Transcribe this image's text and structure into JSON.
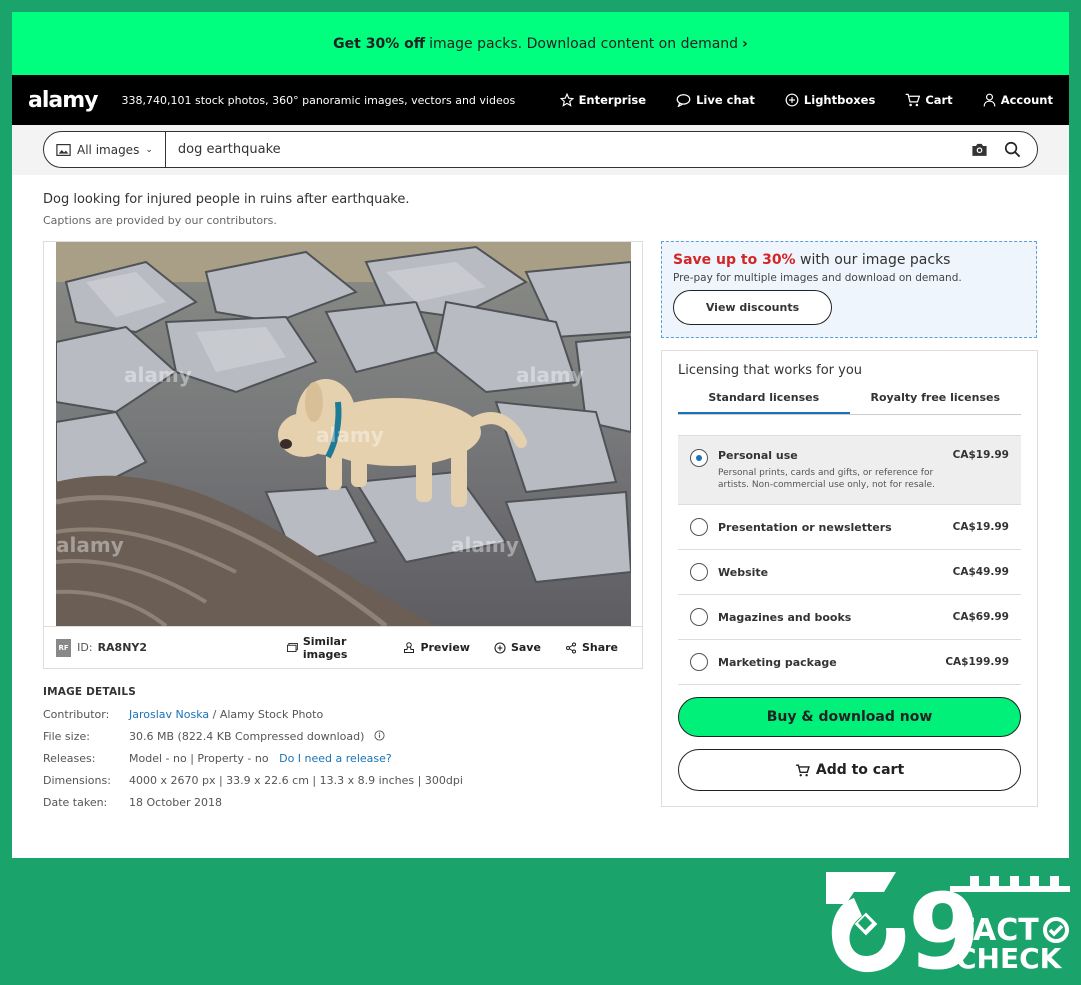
{
  "promo": {
    "bold": "Get 30% off",
    "text": "image packs. Download content on demand",
    "chevron": "›"
  },
  "nav": {
    "logo": "alamy",
    "tagline": "338,740,101 stock photos, 360° panoramic images, vectors and videos",
    "items": [
      {
        "label": "Enterprise",
        "icon": "star-icon"
      },
      {
        "label": "Live chat",
        "icon": "chat-icon"
      },
      {
        "label": "Lightboxes",
        "icon": "plus-circle-icon"
      },
      {
        "label": "Cart",
        "icon": "cart-icon"
      },
      {
        "label": "Account",
        "icon": "user-icon"
      }
    ]
  },
  "search": {
    "scope": "All images",
    "query": "dog earthquake"
  },
  "caption": {
    "title": "Dog looking for injured people in ruins after earthquake.",
    "note": "Captions are provided by our contributors."
  },
  "photo": {
    "watermark": "alamy",
    "rf": "RF",
    "id_label": "ID:",
    "id": "RA8NY2",
    "actions": {
      "similar": "Similar images",
      "preview": "Preview",
      "save": "Save",
      "share": "Share"
    }
  },
  "details": {
    "heading": "IMAGE DETAILS",
    "contributor_label": "Contributor:",
    "contributor_name": "Jaroslav Noska",
    "contributor_rest": "/ Alamy Stock Photo",
    "filesize_label": "File size:",
    "filesize": "30.6 MB (822.4 KB Compressed download)",
    "releases_label": "Releases:",
    "releases": "Model - no | Property - no",
    "release_link": "Do I need a release?",
    "dimensions_label": "Dimensions:",
    "dimensions": "4000 x 2670 px | 33.9 x 22.6 cm | 13.3 x 8.9 inches | 300dpi",
    "date_label": "Date taken:",
    "date": "18 October 2018"
  },
  "savebox": {
    "highlight": "Save up to 30%",
    "title_rest": "with our image packs",
    "sub": "Pre-pay for multiple images and download on demand.",
    "button": "View discounts"
  },
  "licensing": {
    "title": "Licensing that works for you",
    "tabs": [
      "Standard licenses",
      "Royalty free licenses"
    ],
    "options": [
      {
        "label": "Personal use",
        "price": "CA$19.99",
        "desc": "Personal prints, cards and gifts, or reference for artists. Non-commercial use only, not for resale.",
        "selected": true
      },
      {
        "label": "Presentation or newsletters",
        "price": "CA$19.99"
      },
      {
        "label": "Website",
        "price": "CA$49.99"
      },
      {
        "label": "Magazines and books",
        "price": "CA$69.99"
      },
      {
        "label": "Marketing package",
        "price": "CA$199.99"
      }
    ],
    "buy": "Buy & download now",
    "cart": "Add to cart"
  },
  "badge": {
    "number": "9",
    "fact": "FACT",
    "check": "CHECK"
  },
  "colors": {
    "outer_bg": "#1ba36c",
    "promo_bg": "#00ff7f",
    "buy_bg": "#00f07a",
    "link": "#1a73b5",
    "save_red": "#d42626"
  }
}
